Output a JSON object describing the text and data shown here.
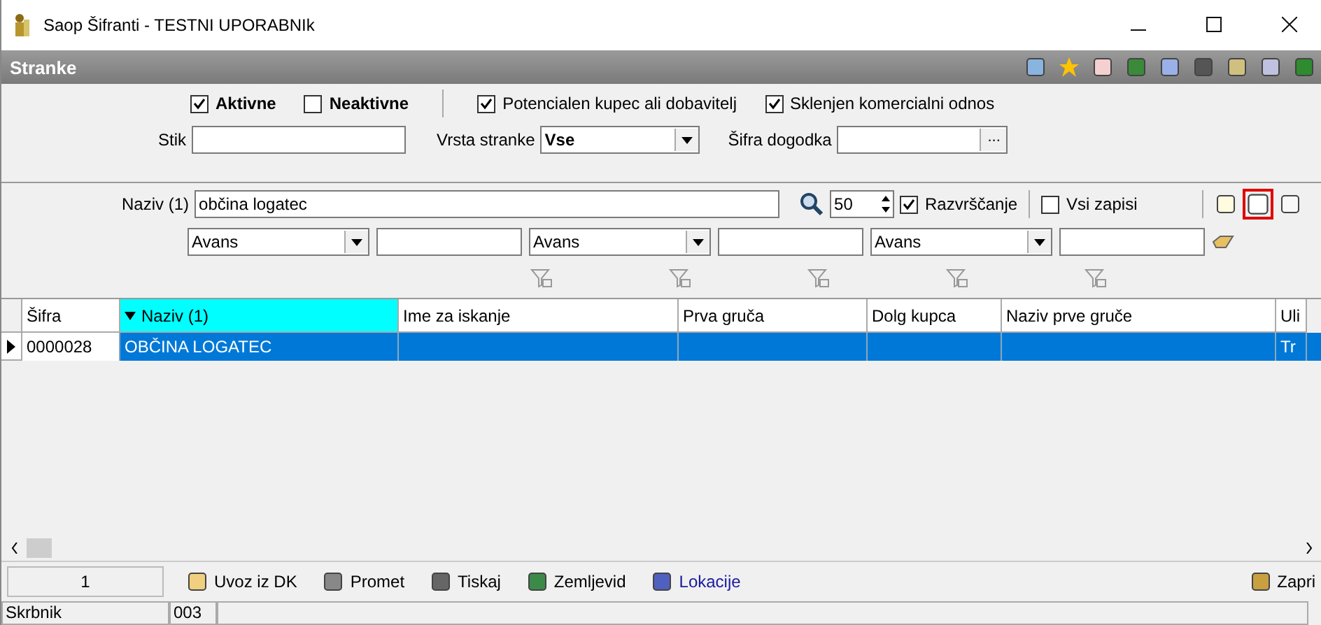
{
  "window": {
    "title": "Saop Šifranti - TESTNI UPORABNIk"
  },
  "panel": {
    "title": "Stranke"
  },
  "filters": {
    "status_checkboxes": [
      {
        "label": "Aktivne",
        "checked": true
      },
      {
        "label": "Neaktivne",
        "checked": false
      }
    ],
    "option_checkboxes": [
      {
        "label": "Potencialen kupec ali dobavitelj",
        "checked": true
      },
      {
        "label": "Sklenjen komercialni odnos",
        "checked": true
      }
    ],
    "stik": {
      "label": "Stik"
    },
    "vrsta_stranke": {
      "label": "Vrsta stranke",
      "value": "Vse"
    },
    "sifra_dogodka": {
      "label": "Šifra dogodka",
      "button": "..."
    }
  },
  "search": {
    "label": "Naziv (1)",
    "value": "občina logatec",
    "count": "50",
    "sort": {
      "label": "Razvrščanje",
      "checked": true
    },
    "all_records": {
      "label": "Vsi zapisi",
      "checked": false
    }
  },
  "filter_selects": [
    "Avans",
    "Avans",
    "Avans"
  ],
  "table": {
    "columns": [
      {
        "label": "Šifra",
        "selected": false
      },
      {
        "label": "Naziv (1)",
        "selected": true
      },
      {
        "label": "Ime za iskanje",
        "selected": false
      },
      {
        "label": "Prva gruča",
        "selected": false
      },
      {
        "label": "Dolg kupca",
        "selected": false
      },
      {
        "label": "Naziv prve gruče",
        "selected": false
      },
      {
        "label": "Uli",
        "selected": false
      }
    ],
    "rows": [
      {
        "sifra": "0000028",
        "naziv": "OBČINA LOGATEC",
        "column_7": "Tr",
        "selected": true
      }
    ]
  },
  "bottom_bar": {
    "counter": "1",
    "buttons": [
      {
        "label": "Uvoz iz DK"
      },
      {
        "label": "Promet"
      },
      {
        "label": "Tiskaj"
      },
      {
        "label": "Zemljevid"
      },
      {
        "label": "Lokacije"
      }
    ],
    "close": "Zapri"
  },
  "status_bar": [
    "Skrbnik",
    "003"
  ]
}
